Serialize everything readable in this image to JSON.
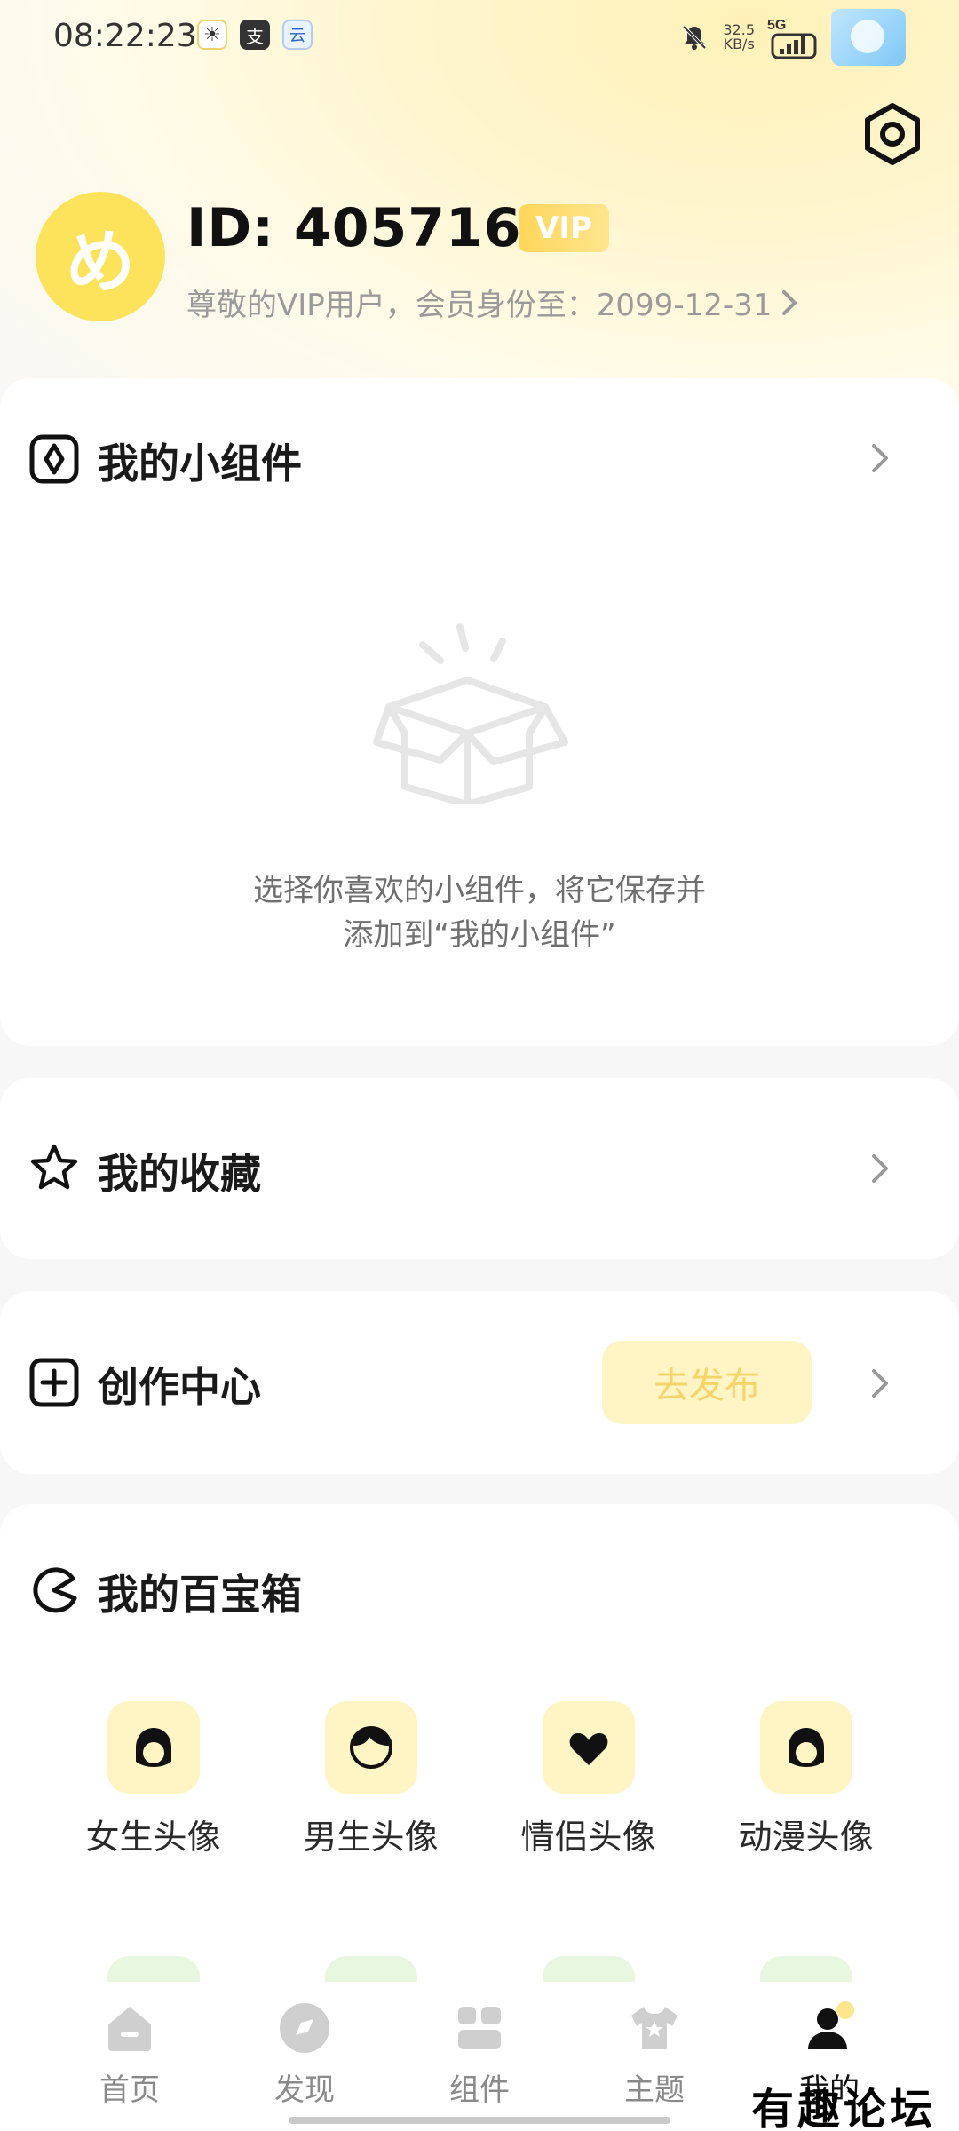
{
  "status_bar": {
    "time": "08:22:23",
    "speed_value": "32.5",
    "speed_unit": "KB/s",
    "network": "5G",
    "app_icons": [
      "sun-icon",
      "alipay-icon",
      "cloud-app-icon"
    ]
  },
  "profile": {
    "avatar_text": "め",
    "id_text": "ID: 4057163",
    "vip_badge": "VIP",
    "subtitle": "尊敬的VIP用户，会员身份至：2099-12-31",
    "accent_color": "#fde35b"
  },
  "widgets_card": {
    "title": "我的小组件",
    "empty_line1": "选择你喜欢的小组件，将它保存并",
    "empty_line2": "添加到“我的小组件”"
  },
  "favorites_card": {
    "title": "我的收藏"
  },
  "create_card": {
    "title": "创作中心",
    "publish_label": "去发布"
  },
  "toolbox_card": {
    "title": "我的百宝箱",
    "items": [
      {
        "label": "女生头像",
        "icon": "girl-avatar-icon"
      },
      {
        "label": "男生头像",
        "icon": "boy-avatar-icon"
      },
      {
        "label": "情侣头像",
        "icon": "heart-icon"
      },
      {
        "label": "动漫头像",
        "icon": "anime-avatar-icon"
      }
    ]
  },
  "bottom_nav": {
    "home": "首页",
    "discover": "发现",
    "widget": "组件",
    "theme": "主题",
    "mine": "我的"
  },
  "watermark": "有趣论坛"
}
